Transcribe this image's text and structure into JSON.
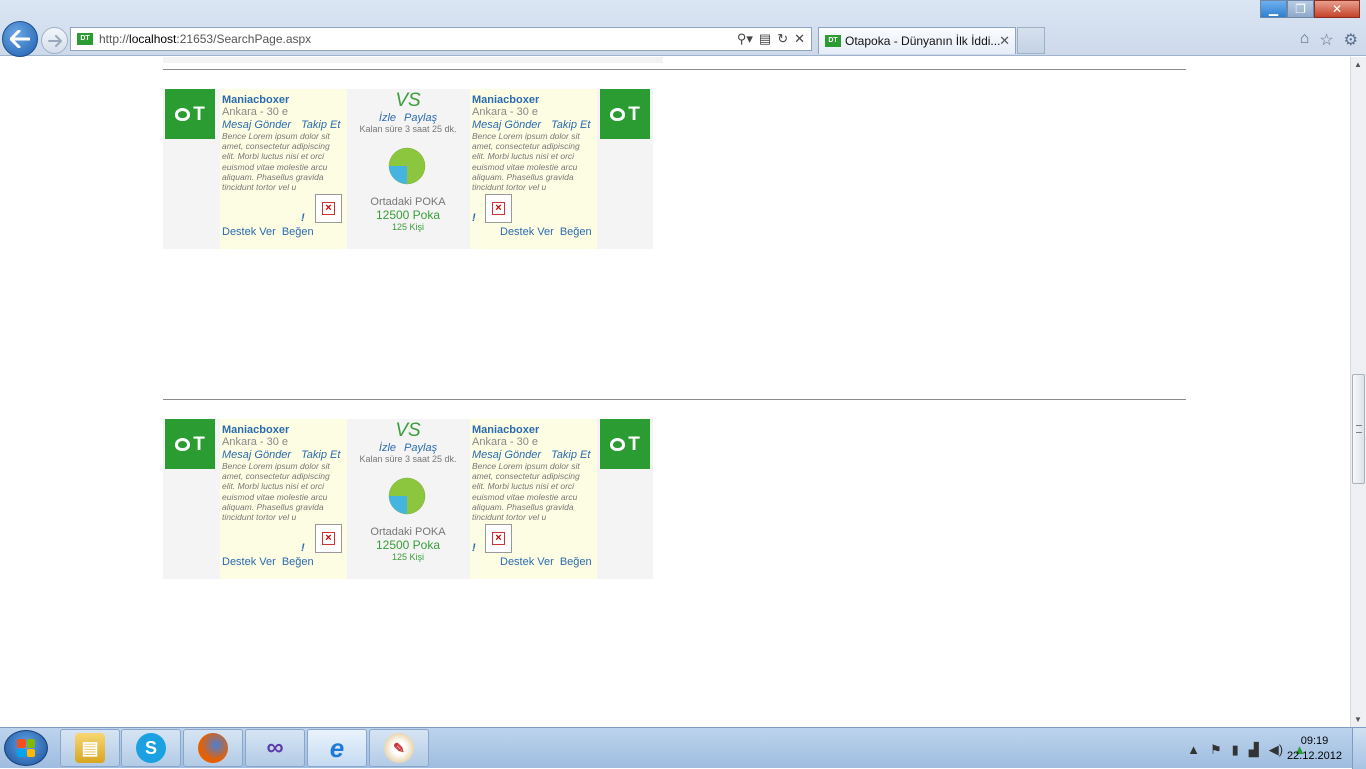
{
  "browser": {
    "url_prefix": "http://",
    "url_host": "localhost",
    "url_rest": ":21653/SearchPage.aspx",
    "tab_title": "Otapoka - Dünyanın İlk İddi...",
    "favicon_text": "DT",
    "icons": [
      "back-icon",
      "forward-icon",
      "search-icon",
      "compat-icon",
      "refresh-icon",
      "stop-icon",
      "home-icon",
      "favorites-star-icon",
      "tools-gear-icon",
      "minimize-icon",
      "restore-icon",
      "close-icon"
    ]
  },
  "matches": [
    {
      "left": {
        "name": "Maniacboxer",
        "city": "Ankara - 30 e",
        "message": "Mesaj Gönder",
        "follow": "Takip Et",
        "desc": "Bence Lorem ipsum dolor sit amet, consectetur adipiscing elit. Morbi luctus nisi et orci euismod vitae molestie arcu aliquam. Phasellus gravida tincidunt tortor vel u",
        "excl": "!",
        "support": "Destek Ver",
        "like": "Beğen"
      },
      "center": {
        "vs": "VS",
        "watch": "İzle",
        "share": "Paylaş",
        "remaining": "Kalan süre 3 saat 25 dk.",
        "pot_label": "Ortadaki POKA",
        "pot": "12500 Poka",
        "people": "125 Kişi"
      },
      "right": {
        "name": "Maniacboxer",
        "city": "Ankara - 30 e",
        "message": "Mesaj Gönder",
        "follow": "Takip Et",
        "desc": "Bence Lorem ipsum dolor sit amet, consectetur adipiscing elit. Morbi luctus nisi et orci euismod vitae molestie arcu aliquam. Phasellus gravida tincidunt tortor vel u",
        "excl": "!",
        "support": "Destek Ver",
        "like": "Beğen"
      }
    },
    {
      "left": {
        "name": "Maniacboxer",
        "city": "Ankara - 30 e",
        "message": "Mesaj Gönder",
        "follow": "Takip Et",
        "desc": "Bence Lorem ipsum dolor sit amet, consectetur adipiscing elit. Morbi luctus nisi et orci euismod vitae molestie arcu aliquam. Phasellus gravida tincidunt tortor vel u",
        "excl": "!",
        "support": "Destek Ver",
        "like": "Beğen"
      },
      "center": {
        "vs": "VS",
        "watch": "İzle",
        "share": "Paylaş",
        "remaining": "Kalan süre 3 saat 25 dk.",
        "pot_label": "Ortadaki POKA",
        "pot": "12500 Poka",
        "people": "125 Kişi"
      },
      "right": {
        "name": "Maniacboxer",
        "city": "Ankara - 30 e",
        "message": "Mesaj Gönder",
        "follow": "Takip Et",
        "desc": "Bence Lorem ipsum dolor sit amet, consectetur adipiscing elit. Morbi luctus nisi et orci euismod vitae molestie arcu aliquam. Phasellus gravida tincidunt tortor vel u",
        "excl": "!",
        "support": "Destek Ver",
        "like": "Beğen"
      }
    }
  ],
  "colors": {
    "brand_green": "#2a9c32",
    "link_blue": "#2b6bb0",
    "player_bg": "#fdfde3",
    "card_bg": "#f4f4f4"
  },
  "taskbar": {
    "apps": [
      "file-explorer-icon",
      "skype-icon",
      "firefox-icon",
      "visual-studio-icon",
      "internet-explorer-icon",
      "paint-icon"
    ],
    "tray_icons": [
      "show-hidden-icons",
      "action-center-flag-icon",
      "battery-icon",
      "network-signal-icon",
      "volume-icon",
      "google-drive-icon"
    ],
    "time": "09:19",
    "date": "22.12.2012"
  }
}
